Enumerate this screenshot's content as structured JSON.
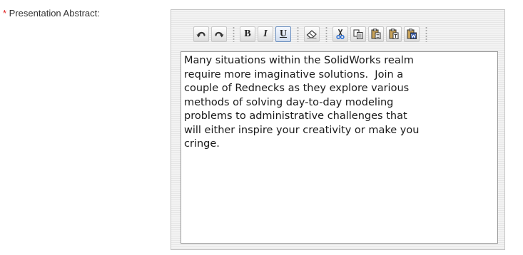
{
  "field": {
    "required_marker": "*",
    "label": " Presentation Abstract:"
  },
  "toolbar": {
    "groups": [
      [
        "undo-icon",
        "redo-icon"
      ],
      [
        "bold",
        "italic",
        "underline"
      ],
      [
        "eraser-icon"
      ],
      [
        "cut-icon",
        "copy-icon",
        "paste-icon",
        "paste-text-icon",
        "paste-word-icon"
      ]
    ],
    "bold_label": "B",
    "italic_label": "I",
    "underline_label": "U",
    "underline_active": true
  },
  "editor": {
    "text": "Many situations within the SolidWorks realm\nrequire more imaginative solutions.  Join a\ncouple of Rednecks as they explore various\nmethods of solving day-to-day modeling\nproblems to administrative challenges that\nwill either inspire your creativity or make you\ncringe."
  }
}
